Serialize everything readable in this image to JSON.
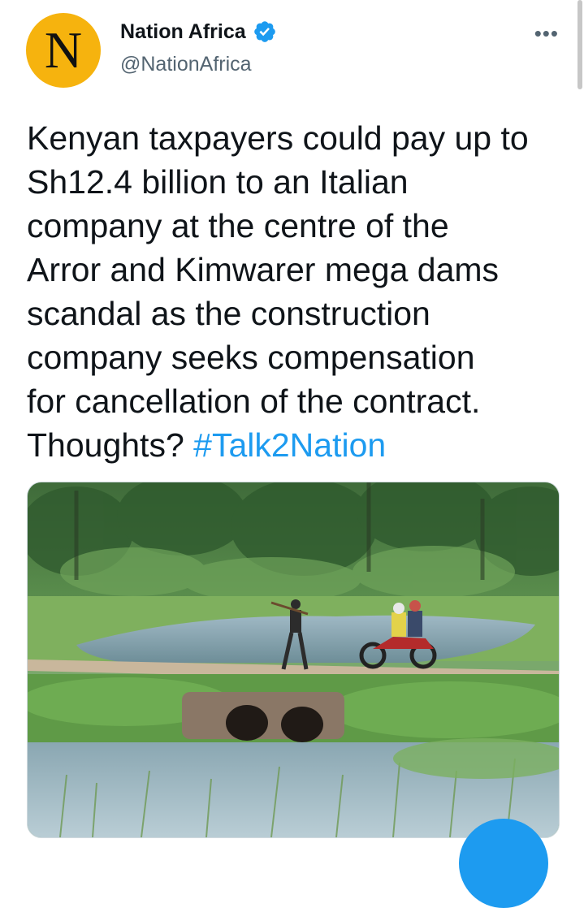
{
  "tweet": {
    "author": {
      "display_name": "Nation Africa",
      "handle": "@NationAfrica",
      "avatar_letter": "N",
      "avatar_color": "#f6b30e",
      "verified": true
    },
    "more_menu_icon": "more-horizontal-icon",
    "text_body": "Kenyan taxpayers could pay up to\nSh12.4 billion to an Italian\ncompany at the centre of the\nArror and Kimwarer mega dams\nscandal as the construction\ncompany seeks compensation\nfor cancellation of the contract.\nThoughts? ",
    "hashtag": "#Talk2Nation",
    "media": {
      "type": "photo",
      "icon": "photo-icon"
    }
  },
  "colors": {
    "accent": "#1d9bf0",
    "text": "#0f1419",
    "secondary_text": "#536471"
  },
  "compose_button": {
    "icon": "compose-icon"
  }
}
